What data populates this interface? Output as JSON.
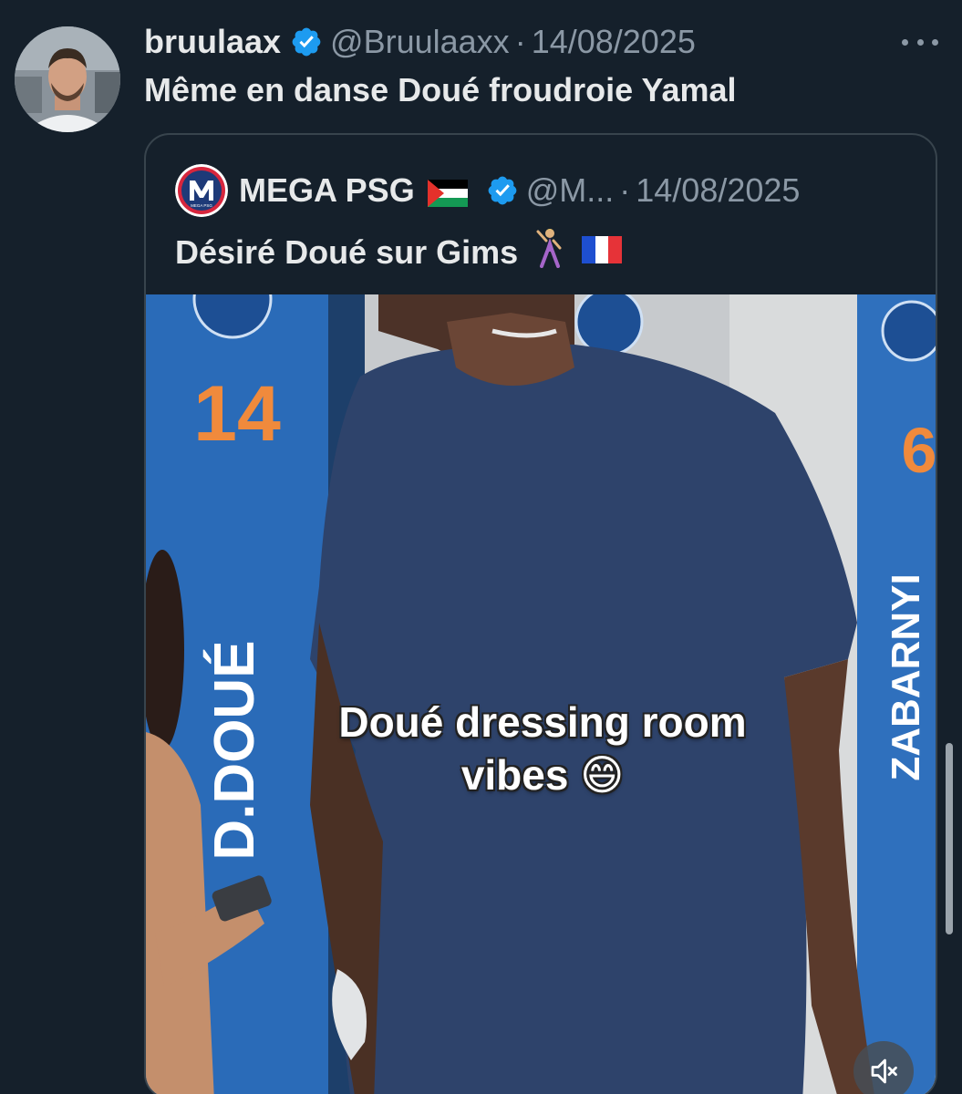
{
  "tweet": {
    "display_name": "bruulaax",
    "handle": "@Bruulaaxx",
    "separator": "·",
    "date": "14/08/2025",
    "text": "Même en danse Doué froudroie Yamal"
  },
  "quoted_tweet": {
    "display_name": "MEGA PSG",
    "handle": "@M...",
    "separator": "·",
    "date": "14/08/2025",
    "text": "Désiré Doué sur Gims",
    "avatar_logo_text": "MEGA PSG"
  },
  "video": {
    "caption_line1": "Doué dressing room",
    "caption_line2": "vibes 😄",
    "locker_left_number": "14",
    "locker_left_name": "D.DOUÉ",
    "locker_right_number": "6",
    "locker_right_name": "ZABARNYI"
  },
  "icons": {
    "verified": "verified-badge-icon",
    "more": "more-options-icon",
    "palestine_flag": "palestine-flag-icon",
    "france_flag": "france-flag-icon",
    "dancer": "dancer-icon",
    "mute": "mute-icon"
  },
  "colors": {
    "background": "#15202b",
    "verified_blue": "#1d9bf0",
    "secondary_text": "#8b98a5",
    "border": "#38444d"
  }
}
